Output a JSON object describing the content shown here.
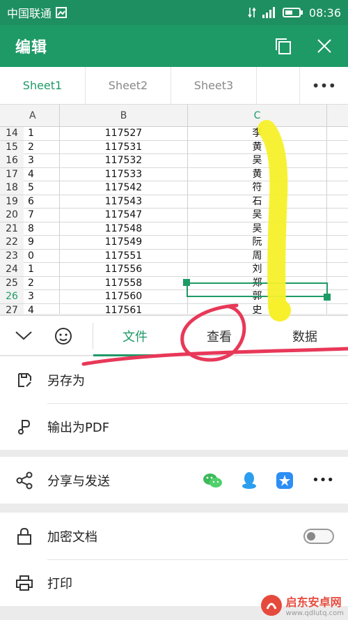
{
  "status": {
    "carrier": "中国联通",
    "time": "08:36"
  },
  "appbar": {
    "title": "编辑"
  },
  "tabs": {
    "items": [
      "Sheet1",
      "Sheet2",
      "Sheet3"
    ],
    "more": "•••"
  },
  "sheet": {
    "columns": [
      "A",
      "B",
      "C"
    ],
    "rows": [
      {
        "n": "14",
        "a": "1",
        "b": "117527",
        "c": "李"
      },
      {
        "n": "15",
        "a": "2",
        "b": "117531",
        "c": "黄"
      },
      {
        "n": "16",
        "a": "3",
        "b": "117532",
        "c": "吴"
      },
      {
        "n": "17",
        "a": "4",
        "b": "117533",
        "c": "黄"
      },
      {
        "n": "18",
        "a": "5",
        "b": "117542",
        "c": "符"
      },
      {
        "n": "19",
        "a": "6",
        "b": "117543",
        "c": "石"
      },
      {
        "n": "20",
        "a": "7",
        "b": "117547",
        "c": "吴"
      },
      {
        "n": "21",
        "a": "8",
        "b": "117548",
        "c": "吴"
      },
      {
        "n": "22",
        "a": "9",
        "b": "117549",
        "c": "阮"
      },
      {
        "n": "23",
        "a": "0",
        "b": "117551",
        "c": "周"
      },
      {
        "n": "24",
        "a": "1",
        "b": "117556",
        "c": "刘"
      },
      {
        "n": "25",
        "a": "2",
        "b": "117558",
        "c": "郑"
      },
      {
        "n": "26",
        "a": "3",
        "b": "117560",
        "c": "郭"
      },
      {
        "n": "27",
        "a": "4",
        "b": "117561",
        "c": "史"
      }
    ]
  },
  "toolbar": {
    "tabs": [
      "文件",
      "查看",
      "数据"
    ]
  },
  "menu": {
    "save_as": "另存为",
    "export_pdf": "输出为PDF",
    "share": "分享与发送",
    "encrypt": "加密文档",
    "print": "打印",
    "more": "•••"
  },
  "watermark": {
    "name": "启东安卓网",
    "url": "www.qdlutq.com"
  },
  "colors": {
    "brand": "#1e9a66",
    "highlight": "#f7f02a",
    "annotation": "#e83858"
  }
}
